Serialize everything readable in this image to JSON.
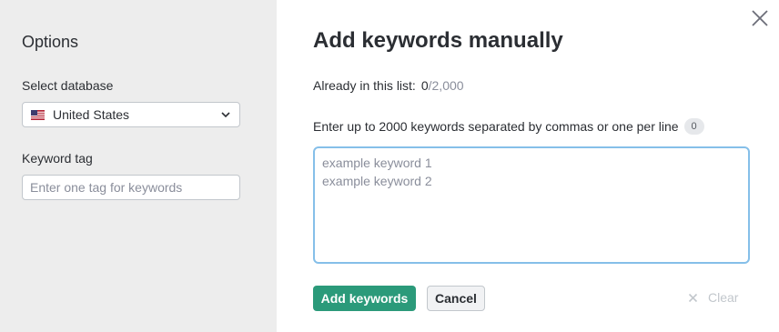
{
  "sidebar": {
    "title": "Options",
    "database_label": "Select database",
    "database_value": "United States",
    "database_flag_icon": "us-flag-icon",
    "tag_label": "Keyword tag",
    "tag_placeholder": "Enter one tag for keywords"
  },
  "main": {
    "title": "Add keywords manually",
    "already_label": "Already in this list:",
    "already_count": "0",
    "already_total": "/2,000",
    "instructions": "Enter up to 2000 keywords separated by commas or one per line",
    "keyword_count": "0",
    "textarea_placeholder": "example keyword 1\nexample keyword 2",
    "add_button": "Add keywords",
    "cancel_button": "Cancel",
    "clear_button": "Clear"
  },
  "colors": {
    "sidebar_bg": "#ededed",
    "primary_button": "#2b9a7a",
    "focus_border": "#85bfe9",
    "muted_text": "#8a8e9b"
  },
  "icons": [
    "us-flag-icon",
    "chevron-down-icon",
    "close-icon",
    "clear-x-icon"
  ]
}
